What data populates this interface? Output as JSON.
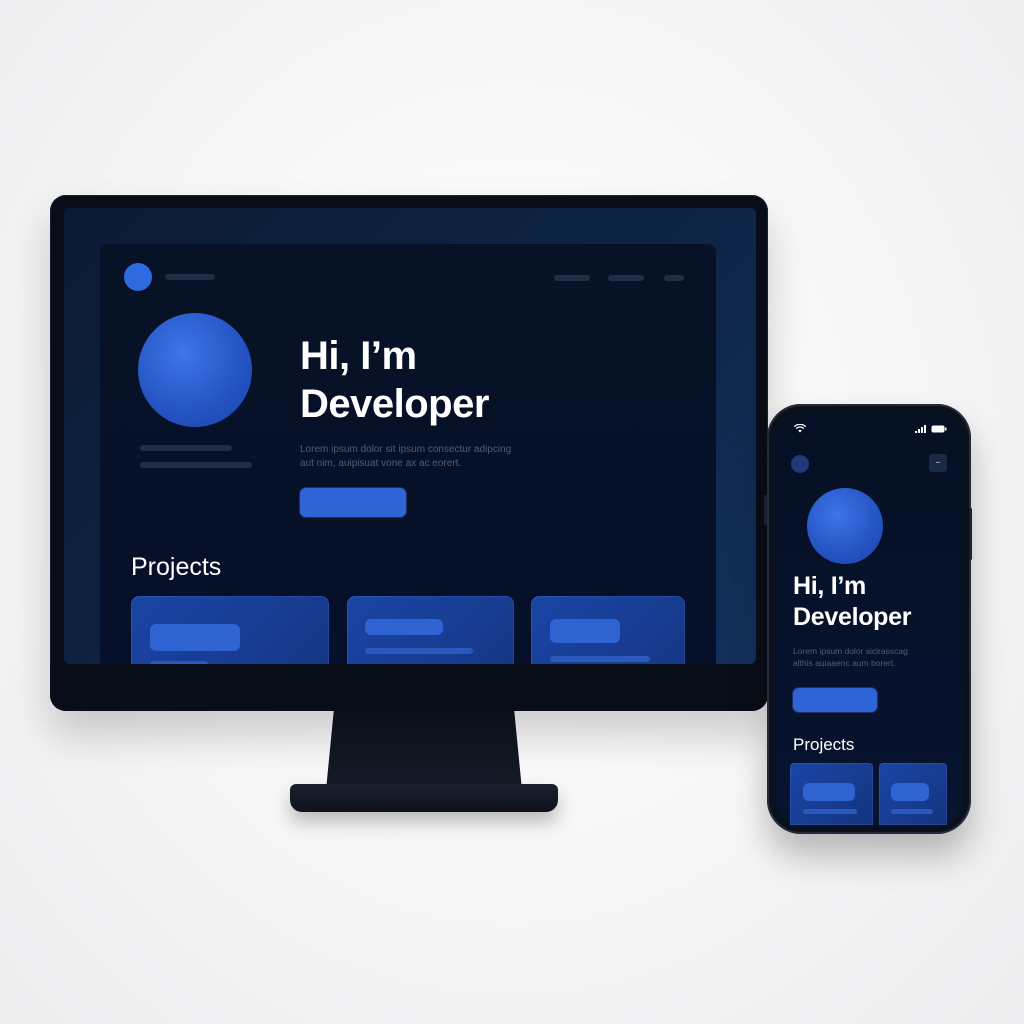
{
  "desktop": {
    "hero": {
      "title_line1": "Hi, I’m",
      "title_line2": "Developer",
      "subtitle_line1": "Lorem ipsum dolor sit ipsum consectur adipcing",
      "subtitle_line2": "aut nim, auipisuat vone ax ac eorert."
    },
    "projects_title": "Projects"
  },
  "mobile": {
    "status": {
      "wifi_icon": "wifi-icon",
      "signal_icon": "signal-icon",
      "battery_icon": "battery-icon"
    },
    "menu_icon": "–",
    "hero": {
      "title_line1": "Hi, I’m",
      "title_line2": "Developer",
      "subtitle_line1": "Lorem ipsum dolor sicirasscag",
      "subtitle_line2": "althis auiaaenc aum borert."
    },
    "projects_title": "Projects"
  },
  "colors": {
    "accent": "#2f64d6",
    "background_dark": "#071226",
    "card": "#1a45a6"
  }
}
